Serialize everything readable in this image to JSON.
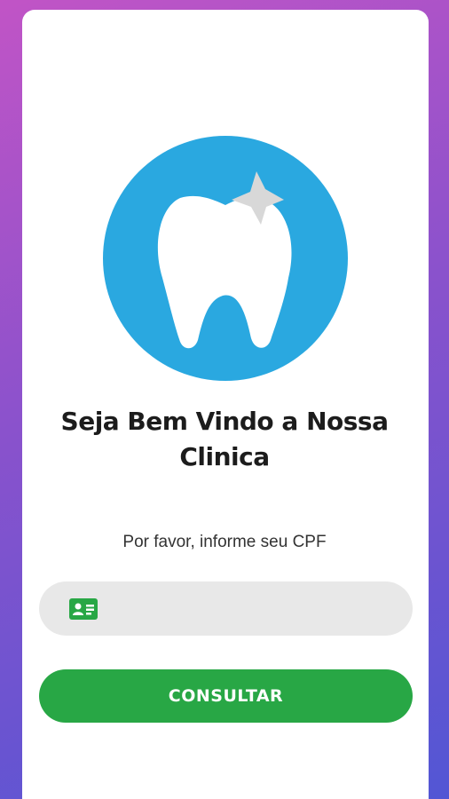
{
  "welcome": {
    "title_line1": "Seja Bem Vindo a Nossa",
    "title_line2": "Clinica",
    "subtitle": "Por favor, informe seu CPF"
  },
  "cpf_input": {
    "value": "",
    "placeholder": "",
    "icon": "id-card-icon"
  },
  "consult_button": {
    "label": "CONSULTAR"
  },
  "colors": {
    "accent_green": "#28a745",
    "logo_blue": "#2aa8e0",
    "input_bg": "#e8e8e8"
  }
}
